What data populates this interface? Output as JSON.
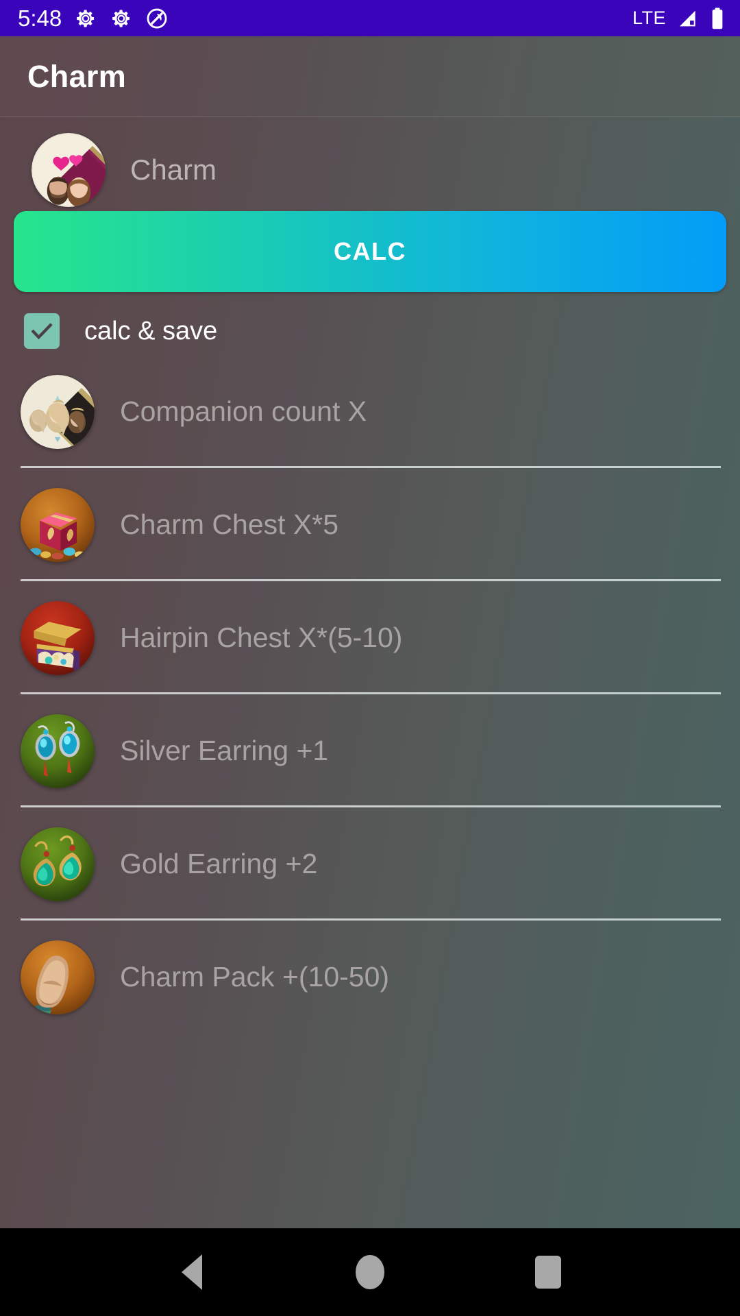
{
  "status_bar": {
    "time": "5:48",
    "icons_left": [
      "gear-icon",
      "gear-icon",
      "do-not-disturb-icon"
    ],
    "network_label": "LTE",
    "icons_right": [
      "signal-icon",
      "battery-icon"
    ],
    "background_color": "#3a04ba"
  },
  "app_bar": {
    "title": "Charm"
  },
  "header": {
    "icon_name": "charm-couple-icon",
    "label": "Charm"
  },
  "calc_button": {
    "label": "CALC",
    "gradient_from": "#26e58c",
    "gradient_to": "#049cf7"
  },
  "checkbox": {
    "label": "calc & save",
    "checked": true,
    "color": "#7cc5b0"
  },
  "list": {
    "items": [
      {
        "icon_name": "companions-icon",
        "label": "Companion count X"
      },
      {
        "icon_name": "charm-chest-icon",
        "label": "Charm Chest X*5"
      },
      {
        "icon_name": "hairpin-chest-icon",
        "label": "Hairpin Chest X*(5-10)"
      },
      {
        "icon_name": "silver-earring-icon",
        "label": "Silver Earring +1"
      },
      {
        "icon_name": "gold-earring-icon",
        "label": "Gold Earring +2"
      },
      {
        "icon_name": "charm-pack-icon",
        "label": "Charm Pack +(10-50)"
      }
    ]
  },
  "nav_bar": {
    "buttons": [
      "back-button",
      "home-button",
      "recents-button"
    ]
  },
  "colors": {
    "background_left": "#5d474c",
    "background_right": "#4b6462",
    "accent_purple": "#3a04ba",
    "label_gray": "#aaa3a3"
  }
}
